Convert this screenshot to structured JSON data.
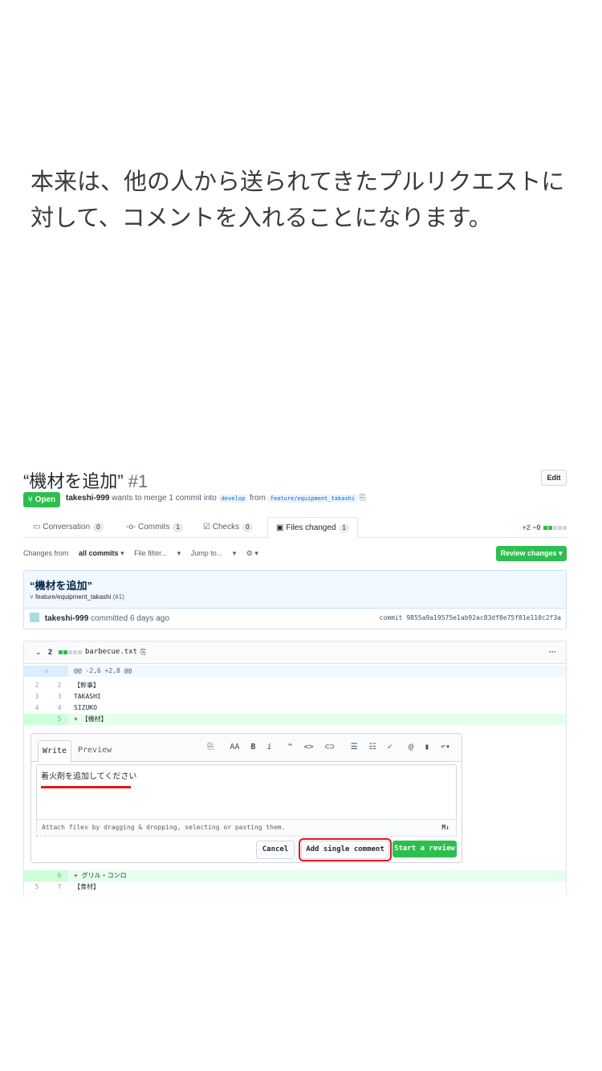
{
  "caption": "本来は、他の人から送られてきたプルリクエストに対して、コメントを入れることになります。",
  "pr": {
    "title": "“機材を追加”",
    "number": "#1",
    "edit_label": "Edit",
    "state": "Open",
    "author": "takeshi-999",
    "merge_text": "wants to merge 1 commit into",
    "base_branch": "develop",
    "from_text": "from",
    "head_branch": "feature/equipment_takashi",
    "copy_icon": "clipboard-icon"
  },
  "tabs": [
    {
      "label": "Conversation",
      "count": "0",
      "icon": "comment-icon"
    },
    {
      "label": "Commits",
      "count": "1",
      "icon": "commit-icon"
    },
    {
      "label": "Checks",
      "count": "0",
      "icon": "checklist-icon"
    },
    {
      "label": "Files changed",
      "count": "1",
      "icon": "file-diff-icon"
    }
  ],
  "diffstat": {
    "additions": "+2",
    "deletions": "−0"
  },
  "toolbar": {
    "changes_from_prefix": "Changes from",
    "changes_from_value": "all commits",
    "file_filter": "File filter...",
    "jump_to": "Jump to...",
    "review_changes": "Review changes"
  },
  "commit": {
    "message": "“機材を追加”",
    "branch": "feature/equipment_takashi",
    "pr_ref": "(#1)",
    "author": "takeshi-999",
    "committed": "committed 6 days ago",
    "sha": "commit 9855a9a19575e1ab92ac83df8e75f81e110c2f3a"
  },
  "file": {
    "changes": "2",
    "name": "barbecue.txt",
    "more": "···",
    "hunk": "@@ -2,6 +2,8 @@",
    "lines": [
      {
        "old": "2",
        "new": "2",
        "code": "  【幹事】"
      },
      {
        "old": "3",
        "new": "3",
        "code": "  TAKASHI"
      },
      {
        "old": "4",
        "new": "4",
        "code": "  SIZUKO"
      },
      {
        "old": "",
        "new": "5",
        "code": "+ 【機材】"
      }
    ],
    "after_lines": [
      {
        "old": "",
        "new": "6",
        "code": "+ グリル・コンロ"
      },
      {
        "old": "5",
        "new": "7",
        "code": "  【食材】"
      }
    ]
  },
  "comment": {
    "tab_write": "Write",
    "tab_preview": "Preview",
    "text": "着火剤を追加してください",
    "attach_hint": "Attach files by dragging & dropping, selecting or pasting them.",
    "markdown_icon": "M↓",
    "cancel": "Cancel",
    "add_single": "Add single comment",
    "start_review": "Start a review"
  }
}
